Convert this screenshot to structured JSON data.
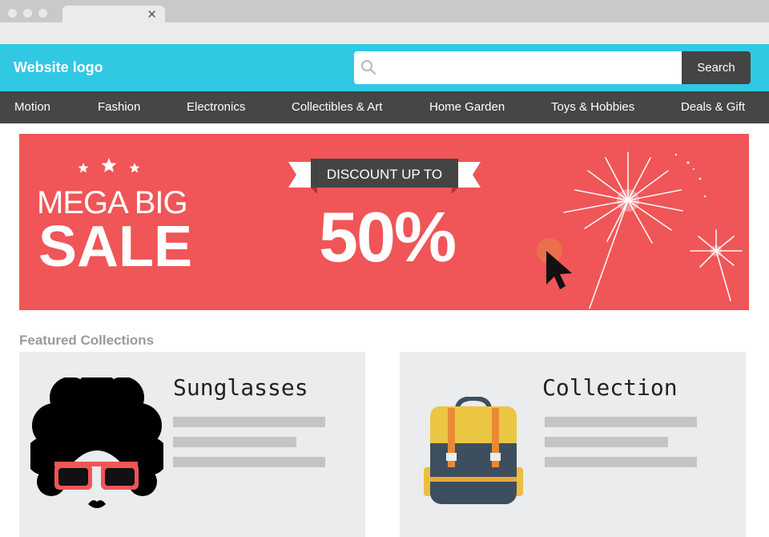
{
  "browser": {
    "tab_close": "✕"
  },
  "header": {
    "logo": "Website logo",
    "search_placeholder": "",
    "search_button": "Search"
  },
  "nav": {
    "items": [
      "Motion",
      "Fashion",
      "Electronics",
      "Collectibles & Art",
      "Home Garden",
      "Toys & Hobbies",
      "Deals & Gift"
    ]
  },
  "banner": {
    "line1": "MEGA BIG",
    "line2": "SALE",
    "discount_label": "DISCOUNT UP TO",
    "discount_value": "50%"
  },
  "featured": {
    "title": "Featured Collections",
    "cards": [
      {
        "title": "Sunglasses",
        "icon": "afro-sunglasses-illustration"
      },
      {
        "title": "Collection",
        "icon": "backpack-illustration"
      }
    ]
  },
  "colors": {
    "header": "#31c8e4",
    "nav": "#464646",
    "banner": "#f05557",
    "card": "#eaeced"
  }
}
